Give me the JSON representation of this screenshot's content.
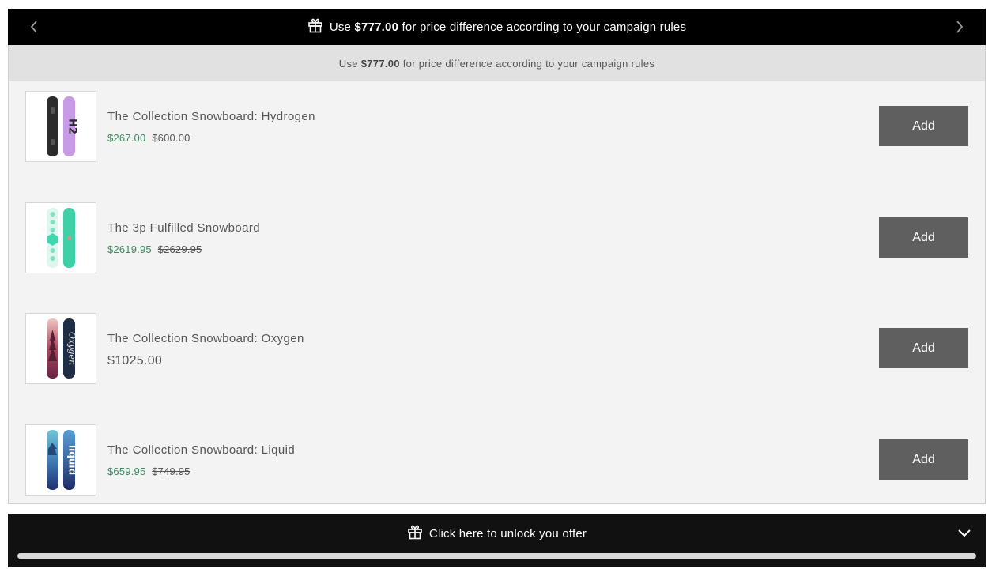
{
  "top_banner": {
    "prefix": "Use",
    "amount": "$777.00",
    "suffix": "for price difference according to your campaign rules"
  },
  "sub_banner": {
    "prefix": "Use",
    "amount": "$777.00",
    "suffix": "for price difference according to your campaign rules"
  },
  "products": [
    {
      "title": "The Collection Snowboard: Hydrogen",
      "sale_price": "$267.00",
      "compare_price": "$600.00",
      "button": "Add",
      "image_icon": "snowboard-hydrogen-icon"
    },
    {
      "title": "The 3p Fulfilled Snowboard",
      "sale_price": "$2619.95",
      "compare_price": "$2629.95",
      "button": "Add",
      "image_icon": "snowboard-3p-fulfilled-icon"
    },
    {
      "title": "The Collection Snowboard: Oxygen",
      "price": "$1025.00",
      "button": "Add",
      "image_icon": "snowboard-oxygen-icon"
    },
    {
      "title": "The Collection Snowboard: Liquid",
      "sale_price": "$659.95",
      "compare_price": "$749.95",
      "button": "Add",
      "image_icon": "snowboard-liquid-icon"
    }
  ],
  "bottom_bar": {
    "label": "Click here to unlock you offer",
    "progress_fraction": 1.0
  },
  "colors": {
    "banner_bg": "#000000",
    "sub_banner_bg": "#e1e1e1",
    "panel_bg": "#f3f3f3",
    "sale_price": "#3c8a62",
    "button_bg": "#5f5f5f",
    "bottom_bar_bg": "#111111"
  }
}
